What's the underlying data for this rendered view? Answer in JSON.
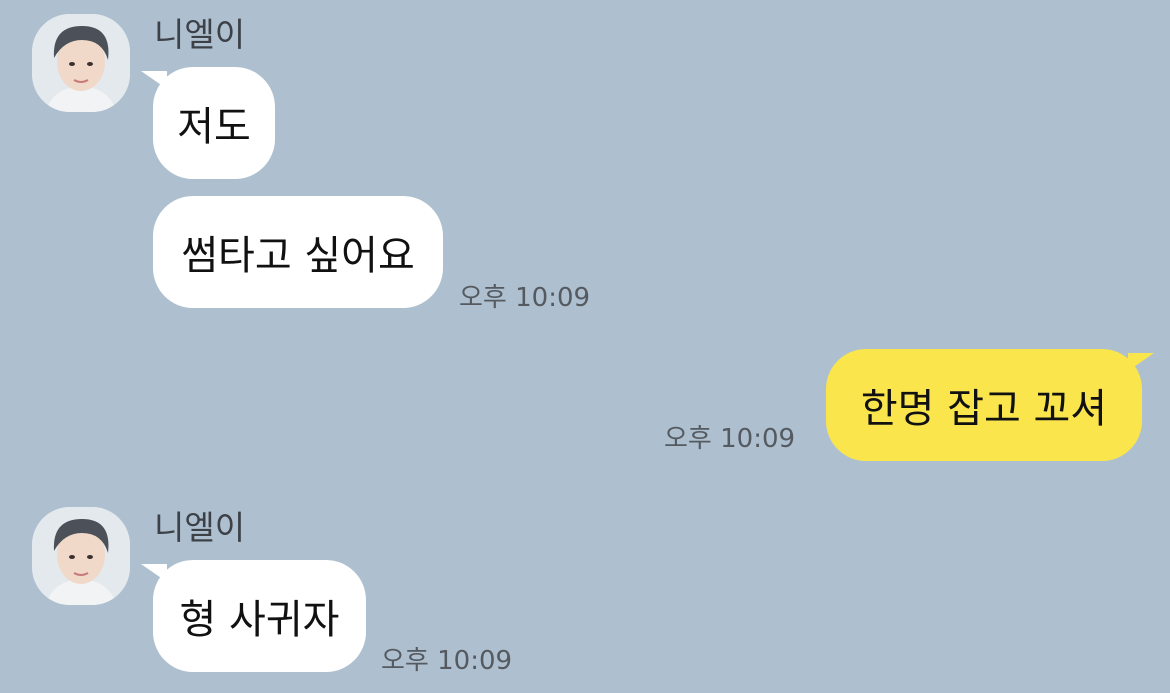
{
  "theme": {
    "background": "#aec0cf",
    "incoming_bubble": "#ffffff",
    "outgoing_bubble": "#fae54d"
  },
  "messages": [
    {
      "direction": "incoming",
      "sender": "니엘이",
      "avatar_icon": "profile-photo",
      "bubbles": [
        "저도",
        "썸타고 싶어요"
      ],
      "time": "오후 10:09"
    },
    {
      "direction": "outgoing",
      "bubbles": [
        "한명 잡고 꼬셔"
      ],
      "time": "오후 10:09"
    },
    {
      "direction": "incoming",
      "sender": "니엘이",
      "avatar_icon": "profile-photo",
      "bubbles": [
        "형 사귀자"
      ],
      "time": "오후 10:09"
    }
  ]
}
